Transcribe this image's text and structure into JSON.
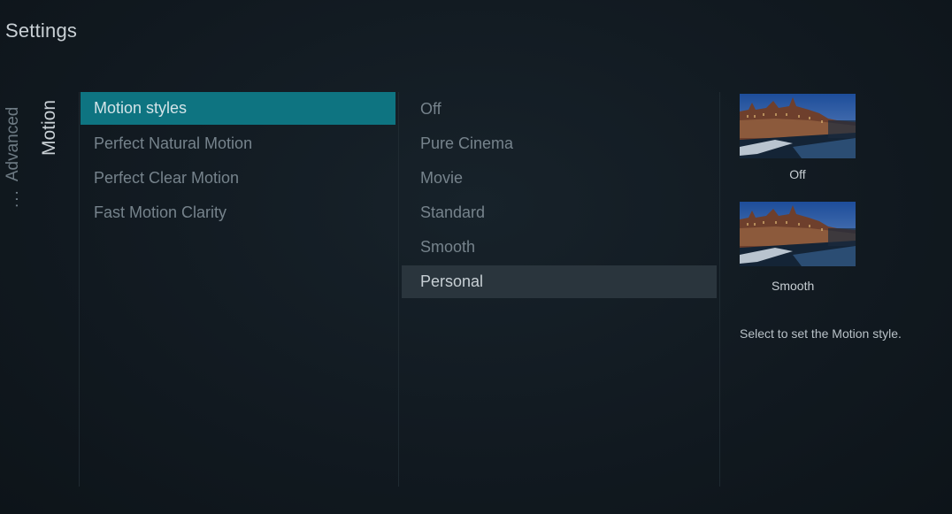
{
  "header": {
    "title": "Settings"
  },
  "breadcrumb": {
    "parent_dots": "...",
    "parent": "Advanced",
    "current": "Motion"
  },
  "menu": {
    "items": [
      {
        "label": "Motion styles"
      },
      {
        "label": "Perfect Natural Motion"
      },
      {
        "label": "Perfect Clear Motion"
      },
      {
        "label": "Fast Motion Clarity"
      }
    ]
  },
  "options": {
    "items": [
      {
        "label": "Off"
      },
      {
        "label": "Pure Cinema"
      },
      {
        "label": "Movie"
      },
      {
        "label": "Standard"
      },
      {
        "label": "Smooth"
      },
      {
        "label": "Personal"
      }
    ]
  },
  "preview": {
    "before_label": "Off",
    "after_label": "Smooth",
    "description": "Select to set the Motion style."
  },
  "colors": {
    "selected_highlight": "#0e7481",
    "focus_highlight": "#2a353d",
    "background": "#121a20"
  }
}
